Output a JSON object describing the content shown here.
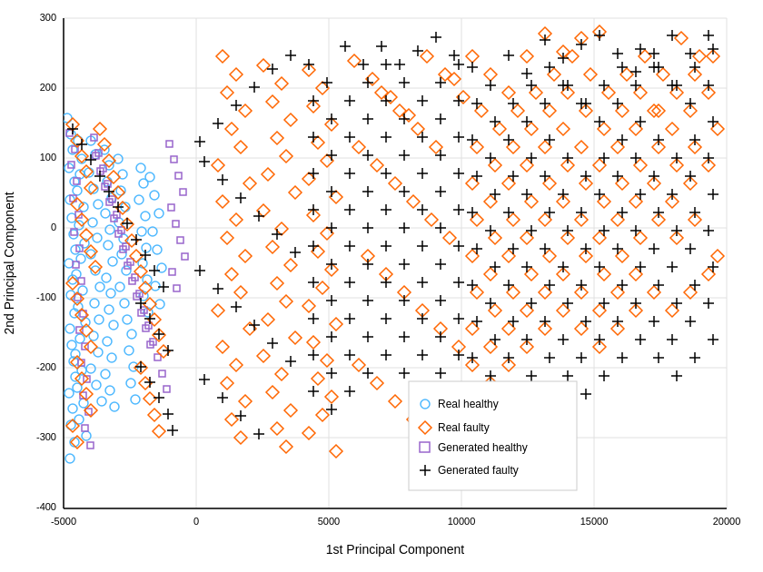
{
  "chart": {
    "title": "",
    "xAxis": {
      "label": "1st Principal Component",
      "min": -5000,
      "max": 20000,
      "ticks": [
        -5000,
        0,
        5000,
        10000,
        15000,
        20000
      ]
    },
    "yAxis": {
      "label": "2nd Principal Component",
      "min": -400,
      "max": 300,
      "ticks": [
        -400,
        -300,
        -200,
        -100,
        0,
        100,
        200,
        300
      ]
    },
    "legend": {
      "items": [
        {
          "label": "Real healthy",
          "type": "circle",
          "color": "#4db8ff"
        },
        {
          "label": "Real faulty",
          "type": "diamond",
          "color": "#ff6600"
        },
        {
          "label": "Generated healthy",
          "type": "square",
          "color": "#9966cc"
        },
        {
          "label": "Generated faulty",
          "type": "plus",
          "color": "#000000"
        }
      ]
    }
  }
}
